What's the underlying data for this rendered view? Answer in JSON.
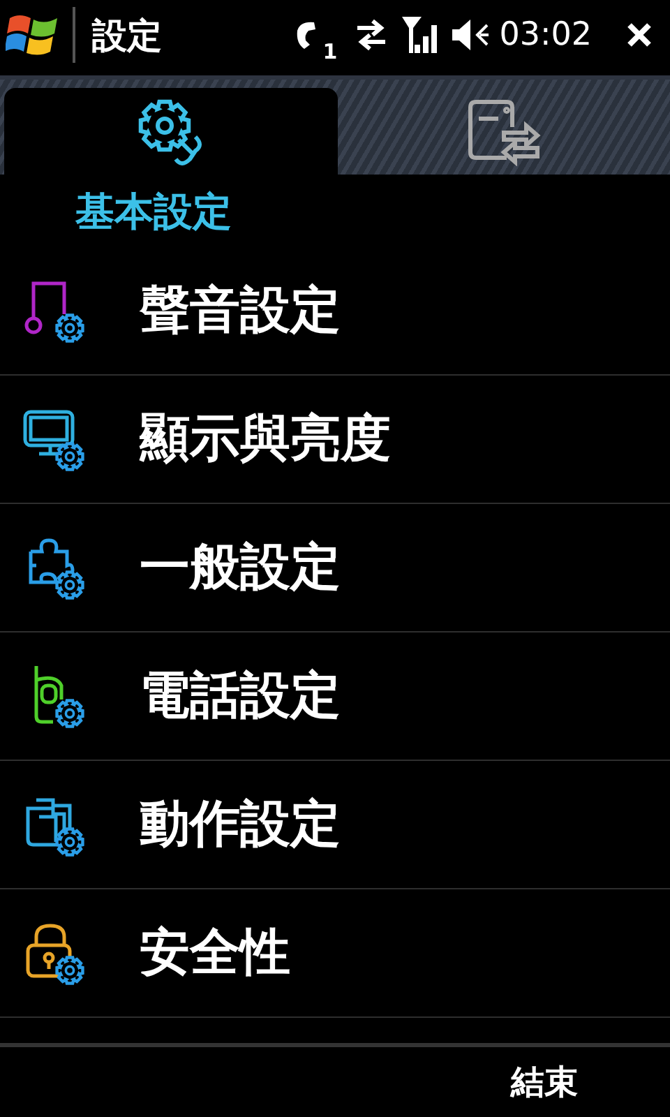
{
  "status_bar": {
    "title": "設定",
    "line_number": "1",
    "muted": true,
    "time": "03:02"
  },
  "tabs": [
    {
      "kind": "gear-wrench",
      "selected": true
    },
    {
      "kind": "device-transfer",
      "selected": false
    }
  ],
  "section_title": "基本設定",
  "items": [
    {
      "label": "聲音設定",
      "kind": "music",
      "color": "#b026c8"
    },
    {
      "label": "顯示與亮度",
      "kind": "monitor",
      "color": "#2fb0e0"
    },
    {
      "label": "一般設定",
      "kind": "puzzle",
      "color": "#2a9ee8"
    },
    {
      "label": "電話設定",
      "kind": "phone",
      "color": "#4fd02a"
    },
    {
      "label": "動作設定",
      "kind": "folders",
      "color": "#2fa8e0"
    },
    {
      "label": "安全性",
      "kind": "lock",
      "color": "#e8a428"
    }
  ],
  "softkey": "結束"
}
